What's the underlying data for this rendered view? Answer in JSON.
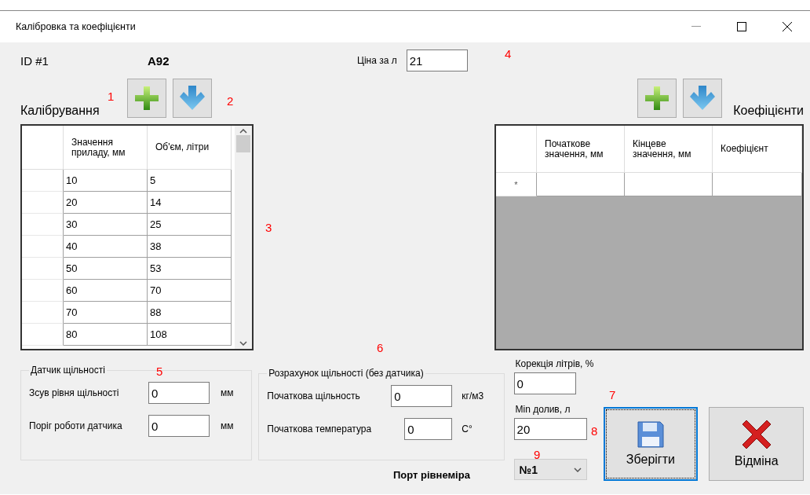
{
  "window": {
    "title": "Калібровка та коефіцієнти"
  },
  "header": {
    "id_label": "ID #1",
    "fuel": "A92",
    "price_label": "Ціна за л",
    "price_value": "21"
  },
  "calibration": {
    "title": "Калібрування",
    "columns": [
      "Значення приладу, мм",
      "Об'єм, літри"
    ],
    "rows": [
      [
        "10",
        "5"
      ],
      [
        "20",
        "14"
      ],
      [
        "30",
        "25"
      ],
      [
        "40",
        "38"
      ],
      [
        "50",
        "53"
      ],
      [
        "60",
        "70"
      ],
      [
        "70",
        "88"
      ],
      [
        "80",
        "108"
      ]
    ]
  },
  "coefficients": {
    "title": "Коефіцієнти",
    "columns": [
      "Початкове значення, мм",
      "Кінцеве значення, мм",
      "Коефіцієнт"
    ],
    "new_row_marker": "*"
  },
  "density_sensor": {
    "title": "Датчик щільності",
    "fields": [
      {
        "label": "Зсув рівня щільності",
        "value": "0",
        "unit": "мм"
      },
      {
        "label": "Поріг роботи датчика",
        "value": "0",
        "unit": "мм"
      }
    ]
  },
  "density_calc": {
    "title": "Розрахунок щільності (без датчика)",
    "fields": [
      {
        "label": "Початкова щільность",
        "value": "0",
        "unit": "кг/м3"
      },
      {
        "label": "Початкова температура",
        "value": "0",
        "unit": "C°"
      }
    ]
  },
  "correction": {
    "label": "Корекція літрів, %",
    "value": "0"
  },
  "min_refill": {
    "label": "Min долив, л",
    "value": "20"
  },
  "port": {
    "label": "Порт рівнеміра",
    "value": "№1"
  },
  "buttons": [
    {
      "kind": "save",
      "label": "Зберігти",
      "focused": true
    },
    {
      "kind": "cancel",
      "label": "Відміна",
      "focused": false
    }
  ],
  "annotations": [
    "1",
    "2",
    "3",
    "4",
    "5",
    "6",
    "7",
    "8",
    "9"
  ]
}
